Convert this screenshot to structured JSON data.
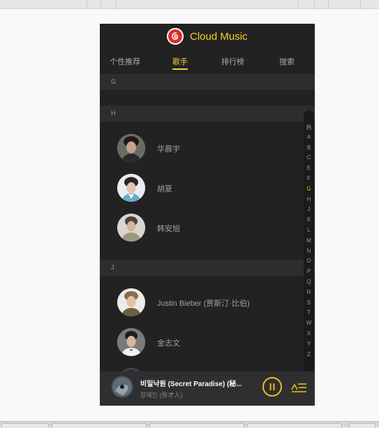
{
  "header": {
    "brand": "Cloud Music"
  },
  "tabs": [
    {
      "label": "个性推荐",
      "active": false
    },
    {
      "label": "歌手",
      "active": true
    },
    {
      "label": "排行榜",
      "active": false
    },
    {
      "label": "搜索",
      "active": false
    }
  ],
  "artist_list": {
    "sections": [
      {
        "letter": "G",
        "artists": []
      },
      {
        "letter": "H",
        "artists": [
          {
            "name": "华晨宇"
          },
          {
            "name": "胡夏"
          },
          {
            "name": "韩安旭"
          }
        ]
      },
      {
        "letter": "J",
        "artists": [
          {
            "name": "Justin Bieber (贾斯汀·比伯)"
          },
          {
            "name": "金志文"
          }
        ]
      }
    ]
  },
  "alphabet_index": {
    "letters": [
      "热",
      "A",
      "B",
      "C",
      "E",
      "F",
      "G",
      "H",
      "J",
      "K",
      "L",
      "M",
      "N",
      "O",
      "P",
      "Q",
      "R",
      "S",
      "T",
      "W",
      "X",
      "Y",
      "Z"
    ],
    "active": "G"
  },
  "player": {
    "title": "비밀낙원 (Secret Paradise) (秘...",
    "artist": "장재인 (张才人)",
    "state": "playing"
  },
  "colors": {
    "accent": "#f4d23a",
    "brand_red": "#e02a2a",
    "background": "#222222",
    "section_header": "#2d2d2d",
    "player_bar": "#2f2f2f"
  },
  "icons": {
    "logo": "netease-cloud-music-logo",
    "play_pause": "pause-icon",
    "playlist": "playlist-icon"
  }
}
